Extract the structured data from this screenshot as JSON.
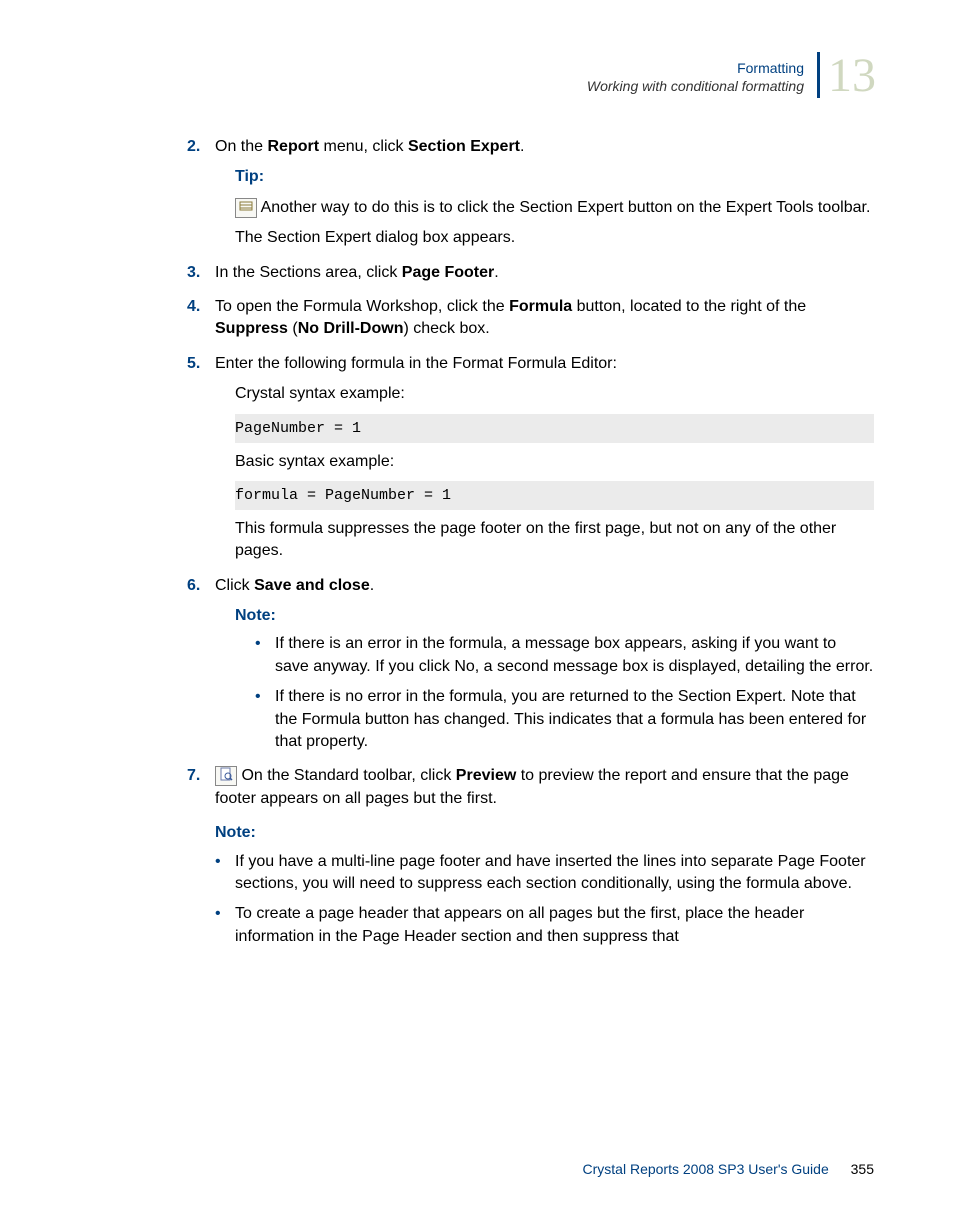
{
  "header": {
    "category": "Formatting",
    "subcategory": "Working with conditional formatting",
    "chapter_number": "13"
  },
  "steps": {
    "s2": {
      "num": "2.",
      "text_pre": "On the ",
      "bold1": "Report",
      "text_mid": " menu, click ",
      "bold2": "Section Expert",
      "text_post": ".",
      "tip_label": "Tip:",
      "tip_text": " Another way to do this is to click the Section Expert button on the Expert Tools toolbar.",
      "after_tip": "The Section Expert dialog box appears."
    },
    "s3": {
      "num": "3.",
      "text_pre": "In the Sections area, click ",
      "bold1": "Page Footer",
      "text_post": "."
    },
    "s4": {
      "num": "4.",
      "text_pre": "To open the Formula Workshop, click the ",
      "bold1": "Formula",
      "text_mid": " button, located to the right of the ",
      "bold2": "Suppress",
      "text_mid2": " (",
      "bold3": "No Drill-Down",
      "text_post": ") check box."
    },
    "s5": {
      "num": "5.",
      "text": "Enter the following formula in the Format Formula Editor:",
      "crystal_label": "Crystal syntax example:",
      "code1": "PageNumber = 1",
      "basic_label": "Basic syntax example:",
      "code2": "formula = PageNumber = 1",
      "after": "This formula suppresses the page footer on the first page, but not on any of the other pages."
    },
    "s6": {
      "num": "6.",
      "text_pre": "Click ",
      "bold1": "Save and close",
      "text_post": ".",
      "note_label": "Note:",
      "bullet1": "If there is an error in the formula, a message box appears, asking if you want to save anyway. If you click No, a second message box is displayed, detailing the error.",
      "bullet2": "If there is no error in the formula, you are returned to the Section Expert. Note that the Formula button has changed. This indicates that a formula has been entered for that property."
    },
    "s7": {
      "num": "7.",
      "text_pre": " On the Standard toolbar, click ",
      "bold1": "Preview",
      "text_post": " to preview the report and ensure that the page footer appears on all pages but the first."
    }
  },
  "bottom_note": {
    "label": "Note:",
    "bullet1": "If you have a multi-line page footer and have inserted the lines into separate Page Footer sections, you will need to suppress each section conditionally, using the formula above.",
    "bullet2": "To create a page header that appears on all pages but the first, place the header information in the Page Header section and then suppress that"
  },
  "footer": {
    "doc_title": "Crystal Reports 2008 SP3 User's Guide",
    "page_number": "355"
  }
}
